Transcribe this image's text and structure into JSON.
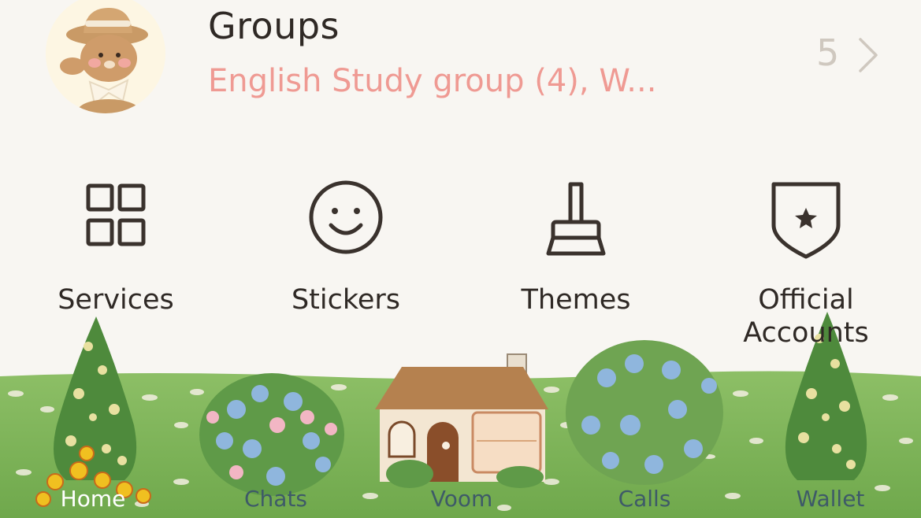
{
  "groups": {
    "title": "Groups",
    "subtitle": "English Study group (4), W...",
    "count": "5"
  },
  "quick_services": [
    {
      "label": "Services",
      "icon": "grid-icon"
    },
    {
      "label": "Stickers",
      "icon": "smiley-icon"
    },
    {
      "label": "Themes",
      "icon": "brush-icon"
    },
    {
      "label": "Official Accounts",
      "icon": "shield-star-icon"
    }
  ],
  "tabbar": {
    "items": [
      {
        "label": "Home",
        "active": true
      },
      {
        "label": "Chats"
      },
      {
        "label": "Voom"
      },
      {
        "label": "Calls"
      },
      {
        "label": "Wallet"
      }
    ]
  },
  "colors": {
    "background": "#f8f6f2",
    "title_text": "#2f2925",
    "group_subtitle": "#ef9a93",
    "count_gray": "#cfc8bf",
    "grass": "#7fb35a",
    "tab_text": "#3e5a68"
  }
}
